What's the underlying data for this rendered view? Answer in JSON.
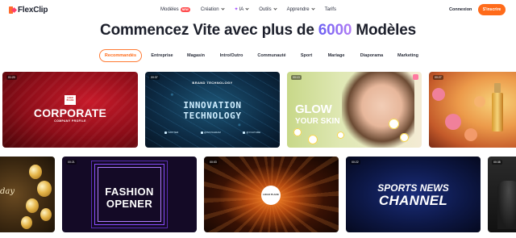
{
  "nav": {
    "logo": "FlexClip",
    "menu": [
      {
        "label": "Modèles",
        "badge": "NEW"
      },
      {
        "label": "Création"
      },
      {
        "label": "IA"
      },
      {
        "label": "Outils"
      },
      {
        "label": "Apprendre"
      },
      {
        "label": "Tarifs"
      }
    ],
    "login": "Connexion",
    "signup": "S'inscrire"
  },
  "headline": {
    "before": "Commencez Vite avec plus de ",
    "number": "6000",
    "after": " Modèles"
  },
  "tabs": [
    "Recommandés",
    "Entreprise",
    "Magasin",
    "Intro/Outro",
    "Communauté",
    "Sport",
    "Mariage",
    "Diaporama",
    "Marketing"
  ],
  "active_tab": "Recommandés",
  "cards": {
    "corporate": {
      "duration": "01:20",
      "logo": "LOGO PLACE",
      "title": "CORPORATE",
      "subtitle": "COMPANY PROFILE"
    },
    "innovation": {
      "duration": "00:37",
      "kicker": "BRAND TECHNOLOGY",
      "line1": "INNOVATION",
      "line2": "TECHNOLOGY",
      "socials": [
        "TWITTER",
        "@INSTAGRAM",
        "@YOUTUBE"
      ]
    },
    "glow": {
      "duration": "00:13",
      "title": "GLOW",
      "subtitle": "YOUR SKIN"
    },
    "perfume": {
      "duration": "00:27"
    },
    "birthday": {
      "script": "day"
    },
    "fashion": {
      "duration": "00:21",
      "line1": "FASHION",
      "line2": "OPENER"
    },
    "logo_reveal": {
      "duration": "00:03",
      "logo": "LOGO PLACE"
    },
    "sports": {
      "duration": "00:22",
      "line1": "SPORTS NEWS",
      "line2": "CHANNEL"
    },
    "person": {
      "duration": "00:38"
    }
  },
  "colors": {
    "accent": "#ff6b1a",
    "headline_number": "#7b6cf0",
    "text": "#1c1f2b"
  }
}
